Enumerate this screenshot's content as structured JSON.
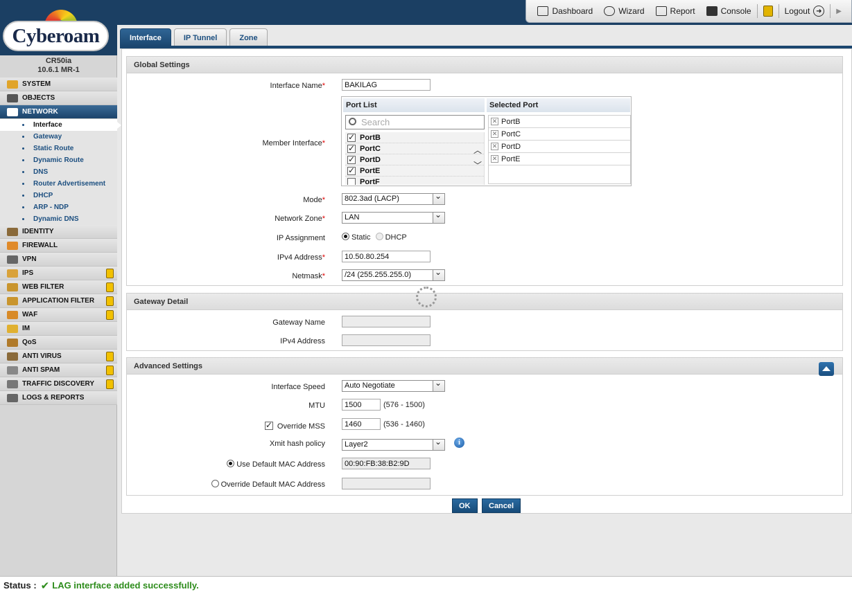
{
  "topnav": {
    "dashboard": "Dashboard",
    "wizard": "Wizard",
    "report": "Report",
    "console": "Console",
    "logout": "Logout"
  },
  "brand": {
    "logo_text": "Cyberoam",
    "model": "CR50ia",
    "version": "10.6.1 MR-1"
  },
  "sidebar": {
    "top_items": [
      {
        "label": "SYSTEM",
        "locked": false
      },
      {
        "label": "OBJECTS",
        "locked": false
      },
      {
        "label": "NETWORK",
        "locked": false,
        "active": true
      }
    ],
    "network_sub": [
      {
        "label": "Interface",
        "active": true
      },
      {
        "label": "Gateway"
      },
      {
        "label": "Static Route"
      },
      {
        "label": "Dynamic Route"
      },
      {
        "label": "DNS"
      },
      {
        "label": "Router Advertisement"
      },
      {
        "label": "DHCP"
      },
      {
        "label": "ARP - NDP"
      },
      {
        "label": "Dynamic DNS"
      }
    ],
    "bottom_items": [
      {
        "label": "IDENTITY",
        "locked": false
      },
      {
        "label": "FIREWALL",
        "locked": false
      },
      {
        "label": "VPN",
        "locked": false
      },
      {
        "label": "IPS",
        "locked": true
      },
      {
        "label": "WEB FILTER",
        "locked": true
      },
      {
        "label": "APPLICATION FILTER",
        "locked": true
      },
      {
        "label": "WAF",
        "locked": true
      },
      {
        "label": "IM",
        "locked": false
      },
      {
        "label": "QoS",
        "locked": false
      },
      {
        "label": "ANTI VIRUS",
        "locked": true
      },
      {
        "label": "ANTI SPAM",
        "locked": true
      },
      {
        "label": "TRAFFIC DISCOVERY",
        "locked": true
      },
      {
        "label": "LOGS & REPORTS",
        "locked": false
      }
    ]
  },
  "tabs": [
    "Interface",
    "IP Tunnel",
    "Zone"
  ],
  "global": {
    "title": "Global Settings",
    "interface_name_label": "Interface Name",
    "interface_name_value": "BAKILAG",
    "member_label": "Member Interface",
    "port_list_header": "Port List",
    "selected_port_header": "Selected Port",
    "search_placeholder": "Search",
    "port_list": [
      "PortB",
      "PortC",
      "PortD",
      "PortE",
      "PortF"
    ],
    "selected_ports": [
      "PortB",
      "PortC",
      "PortD",
      "PortE"
    ],
    "mode_label": "Mode",
    "mode_value": "802.3ad (LACP)",
    "zone_label": "Network Zone",
    "zone_value": "LAN",
    "ip_assign_label": "IP Assignment",
    "static_label": "Static",
    "dhcp_label": "DHCP",
    "ipv4_label": "IPv4 Address",
    "ipv4_value": "10.50.80.254",
    "netmask_label": "Netmask",
    "netmask_value": "/24 (255.255.255.0)"
  },
  "gateway": {
    "title": "Gateway Detail",
    "name_label": "Gateway Name",
    "ipv4_label": "IPv4 Address"
  },
  "advanced": {
    "title": "Advanced Settings",
    "speed_label": "Interface Speed",
    "speed_value": "Auto Negotiate",
    "mtu_label": "MTU",
    "mtu_value": "1500",
    "mtu_hint": "(576 - 1500)",
    "mss_label": "Override MSS",
    "mss_value": "1460",
    "mss_hint": "(536 - 1460)",
    "xmit_label": "Xmit hash policy",
    "xmit_value": "Layer2",
    "default_mac_label": "Use Default MAC Address",
    "default_mac_value": "00:90:FB:38:B2:9D",
    "override_mac_label": "Override Default MAC Address"
  },
  "buttons": {
    "ok": "OK",
    "cancel": "Cancel"
  },
  "status": {
    "label": "Status :",
    "message": "LAG interface added successfully."
  }
}
